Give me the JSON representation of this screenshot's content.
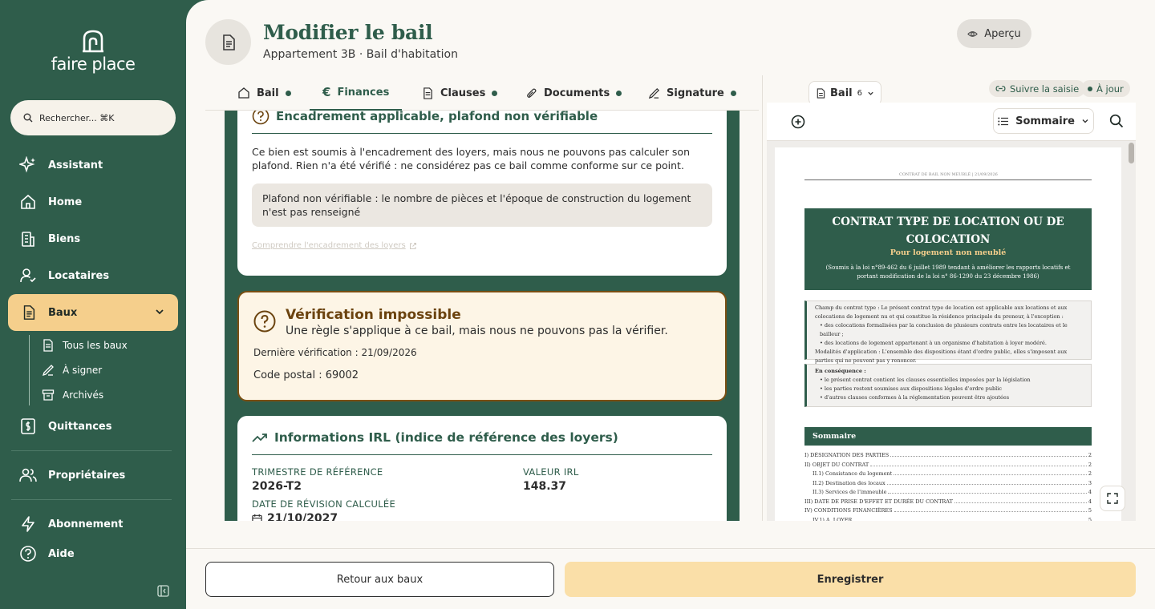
{
  "brand": {
    "name": "faire place"
  },
  "search": {
    "placeholder": "Rechercher... ⌘K"
  },
  "sidebar": {
    "items": [
      {
        "label": "Assistant",
        "icon": "sparkle-icon"
      },
      {
        "label": "Home",
        "icon": "home-icon"
      },
      {
        "label": "Biens",
        "icon": "building-icon"
      },
      {
        "label": "Locataires",
        "icon": "user-icon"
      },
      {
        "label": "Baux",
        "icon": "document-icon",
        "active": true
      },
      {
        "label": "Quittances",
        "icon": "receipt-icon"
      },
      {
        "label": "Propriétaires",
        "icon": "users-icon"
      },
      {
        "label": "Abonnement",
        "icon": "bolt-icon"
      },
      {
        "label": "Aide",
        "icon": "help-icon"
      }
    ],
    "subitems": [
      {
        "label": "Tous les baux",
        "icon": "document-icon"
      },
      {
        "label": "À signer",
        "icon": "signature-icon"
      },
      {
        "label": "Archivés",
        "icon": "archive-icon"
      }
    ]
  },
  "header": {
    "title": "Modifier le bail",
    "subtitle": "Appartement 3B · Bail d'habitation",
    "preview_label": "Aperçu"
  },
  "tabs": [
    {
      "label": "Bail",
      "dot": true
    },
    {
      "label": "Finances",
      "dot": false,
      "active": true
    },
    {
      "label": "Clauses",
      "dot": true
    },
    {
      "label": "Documents",
      "dot": true
    },
    {
      "label": "Signature",
      "dot": true
    }
  ],
  "cards": {
    "encadrement": {
      "title": "Encadrement applicable, plafond non vérifiable",
      "body": "Ce bien est soumis à l'encadrement des loyers, mais nous ne pouvons pas calculer son plafond. Rien n'a été vérifié : ne considérez pas ce bail comme conforme sur ce point.",
      "note": "Plafond non vérifiable : le nombre de pièces et l'époque de construction du logement n'est pas renseigné",
      "link": "Comprendre l'encadrement des loyers"
    },
    "verification": {
      "title": "Vérification impossible",
      "subtitle": "Une règle s'applique à ce bail, mais nous ne pouvons pas la vérifier.",
      "last_check": "Dernière vérification : 21/09/2026",
      "postal": "Code postal : 69002"
    },
    "irl": {
      "title": "Informations IRL (indice de référence des loyers)",
      "trimestre_label": "TRIMESTRE DE RÉFÉRENCE",
      "trimestre_value": "2026-T2",
      "valeur_label": "VALEUR IRL",
      "valeur_value": "148.37",
      "date_label": "DATE DE RÉVISION CALCULÉE",
      "date_value": "21/10/2027"
    }
  },
  "preview": {
    "doc_selector": "Bail",
    "doc_count": "6",
    "chip_follow": "Suivre la saisie",
    "chip_status": "À jour",
    "sommaire_label": "Sommaire",
    "doc": {
      "header": "CONTRAT DE BAIL NON MEUBLÉ | 21/09/2026",
      "title": "CONTRAT TYPE DE LOCATION OU DE COLOCATION",
      "subtitle": "Pour logement non meublé",
      "desc": "(Soumis à la loi n°89-462 du 6 juillet 1989 tendant à améliorer les rapports locatifs et portant modification de la loi n° 86-1290 du 23 décembre 1986)",
      "box1": [
        "Champ du contrat type : Le présent contrat type de location est applicable aux locations et aux colocations de logement nu et qui constitue la résidence principale du preneur, à l'exception :",
        "• des colocations formalisées par la conclusion de plusieurs contrats entre les locataires et le bailleur ;",
        "• des locations de logement appartenant à un organisme d'habitation à loyer modéré.",
        "Modalités d'application : L'ensemble des dispositions étant d'ordre public, elles s'imposent aux parties qui ne peuvent pas y renoncer."
      ],
      "box2": [
        "En conséquence :",
        "• le présent contrat contient les clauses essentielles imposées par la législation",
        "• les parties restent soumises aux dispositions légales d'ordre public",
        "• d'autres clauses conformes à la réglementation peuvent être ajoutées"
      ],
      "sommaire": "Sommaire",
      "toc": [
        {
          "label": "I)  DÉSIGNATION DES PARTIES",
          "page": "2",
          "indent": 0
        },
        {
          "label": "II)  OBJET DU CONTRAT",
          "page": "2",
          "indent": 0
        },
        {
          "label": "II.1)  Consistance du logement",
          "page": "2",
          "indent": 1
        },
        {
          "label": "II.2)  Destination des locaux",
          "page": "3",
          "indent": 1
        },
        {
          "label": "II.3)  Services de l'immeuble",
          "page": "4",
          "indent": 1
        },
        {
          "label": "III)  DATE DE PRISE D'EFFET ET DURÉE DU CONTRAT",
          "page": "4",
          "indent": 0
        },
        {
          "label": "IV)  CONDITIONS FINANCIÈRES",
          "page": "5",
          "indent": 0
        },
        {
          "label": "IV.1)  A. LOYER",
          "page": "5",
          "indent": 1
        }
      ]
    }
  },
  "footer": {
    "back_label": "Retour aux baux",
    "save_label": "Enregistrer"
  },
  "colors": {
    "brand_green": "#2f5d4b",
    "accent_yellow": "#f5cf8c",
    "warning_brown": "#7a4f13"
  }
}
